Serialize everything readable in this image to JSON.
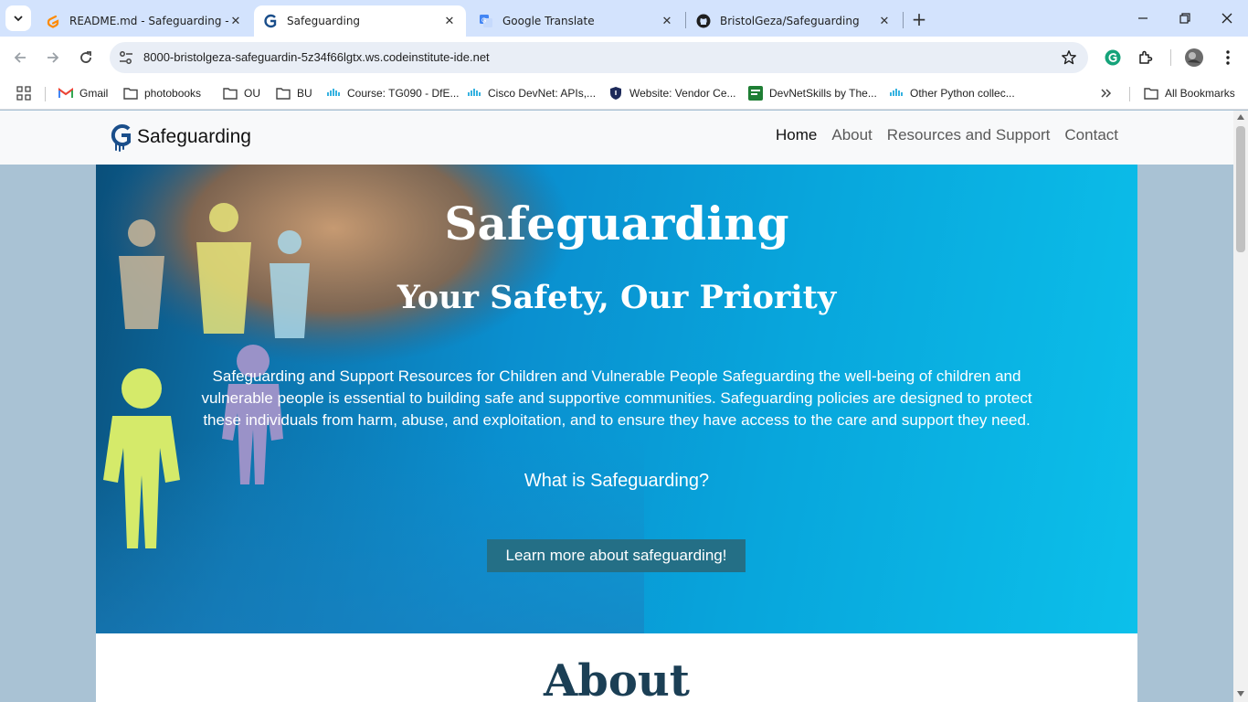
{
  "browser": {
    "tabs": [
      {
        "title": "README.md - Safeguarding - G",
        "icon": "gitpod-icon",
        "active": false
      },
      {
        "title": "Safeguarding",
        "icon": "safeguarding-favicon",
        "active": true
      },
      {
        "title": "Google Translate",
        "icon": "google-translate-icon",
        "active": false
      },
      {
        "title": "BristolGeza/Safeguarding",
        "icon": "github-icon",
        "active": false
      }
    ],
    "url": "8000-bristolgeza-safeguardin-5z34f66lgtx.ws.codeinstitute-ide.net",
    "bookmarks": [
      {
        "label": "Gmail",
        "icon": "gmail-icon"
      },
      {
        "label": "photobooks",
        "icon": "folder-icon"
      },
      {
        "label": "OU",
        "icon": "folder-icon"
      },
      {
        "label": "BU",
        "icon": "folder-icon"
      },
      {
        "label": "Course: TG090 - DfE...",
        "icon": "cisco-icon"
      },
      {
        "label": "Cisco DevNet: APIs,...",
        "icon": "cisco-icon"
      },
      {
        "label": "Website: Vendor Ce...",
        "icon": "shield-icon"
      },
      {
        "label": "DevNetSkills by The...",
        "icon": "devnetskills-icon"
      },
      {
        "label": "Other Python collec...",
        "icon": "cisco-icon"
      }
    ],
    "all_bookmarks_label": "All Bookmarks"
  },
  "site": {
    "brand": "Safeguarding",
    "nav": [
      {
        "label": "Home",
        "active": true
      },
      {
        "label": "About",
        "active": false
      },
      {
        "label": "Resources and Support",
        "active": false
      },
      {
        "label": "Contact",
        "active": false
      }
    ],
    "hero": {
      "title": "Safeguarding",
      "subtitle": "Your Safety, Our Priority",
      "text": "Safeguarding and Support Resources for Children and Vulnerable People Safeguarding the well-being of children and vulnerable people is essential to building safe and supportive communities. Safeguarding policies are designed to protect these individuals from harm, abuse, and exploitation, and to ensure they have access to the care and support they need.",
      "question": "What is Safeguarding?",
      "button": "Learn more about safeguarding!"
    },
    "about_heading": "About"
  },
  "colors": {
    "tabbar": "#d3e3fd",
    "page_bg": "#a9c2d4",
    "hero_button": "#246f86",
    "about_heading": "#1b3f55"
  }
}
